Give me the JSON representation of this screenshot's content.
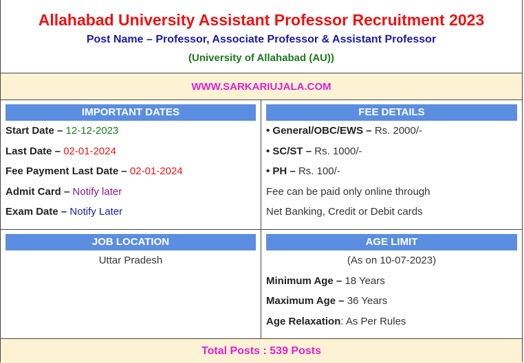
{
  "header": {
    "title": "Allahabad University Assistant Professor Recruitment 2023",
    "post_name": "Post Name – Professor, Associate Professor & Assistant Professor",
    "university": "(University of Allahabad (AU))"
  },
  "website": "WWW.SARKARIUJALA.COM",
  "important_dates": {
    "heading": "IMPORTANT DATES",
    "start_label": "Start Date –",
    "start_value": "12-12-2023",
    "last_label": "Last Date –",
    "last_value": "02-01-2024",
    "fee_label": "Fee Payment Last Date –",
    "fee_value": "02-01-2024",
    "admit_label": "Admit Card –",
    "admit_value": "Notify later",
    "exam_label": "Exam Date –",
    "exam_value": "Notify Later"
  },
  "fee_details": {
    "heading": "FEE DETAILS",
    "general_label": "• General/OBC/EWS –",
    "general_value": "Rs. 2000/-",
    "scst_label": "• SC/ST –",
    "scst_value": "Rs. 1000/-",
    "ph_label": "• PH –",
    "ph_value": "Rs. 100/-",
    "note1": "Fee can be paid only online through",
    "note2": "Net Banking, Credit or Debit cards"
  },
  "job_location": {
    "heading": "JOB LOCATION",
    "value": "Uttar Pradesh"
  },
  "age_limit": {
    "heading": "AGE LIMIT",
    "as_on": "(As on 10-07-2023)",
    "min_label": "Minimum Age –",
    "min_value": "18 Years",
    "max_label": "Maximum Age –",
    "max_value": "36 Years",
    "relax_label": "Age Relaxation",
    "relax_value": ": As Per Rules"
  },
  "total_posts": "Total Posts : 539 Posts",
  "colors": {
    "title": "#ee1111",
    "post_name": "#1a1aa6",
    "university": "#1a7a1a",
    "highlight": "#e020d0",
    "header_bar": "#5b8ee0",
    "band": "#fdf3d4"
  }
}
